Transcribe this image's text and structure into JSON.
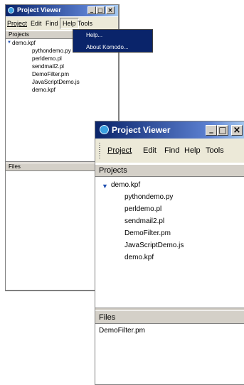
{
  "small_window": {
    "title": "Project Viewer",
    "controls": {
      "minimize": "_",
      "maximize": "□",
      "close": "×"
    },
    "menu": [
      "Project",
      "Edit",
      "Find",
      "Help",
      "Tools"
    ],
    "open_menu": "Help",
    "help_menu": [
      "Help...",
      "About Komodo..."
    ],
    "projects_header": "Projects",
    "tree": {
      "root": "demo.kpf",
      "children": [
        "pythondemo.py",
        "perldemo.pl",
        "sendmail2.pl",
        "DemoFilter.pm",
        "JavaScriptDemo.js",
        "demo.kpf"
      ]
    },
    "files_header": "Files"
  },
  "large_window": {
    "title": "Project Viewer",
    "controls": {
      "minimize": "_",
      "maximize": "□",
      "close": "×"
    },
    "menu": [
      "Project",
      "Edit",
      "Find",
      "Help",
      "Tools"
    ],
    "projects_header": "Projects",
    "tree": {
      "root": "demo.kpf",
      "children": [
        "pythondemo.py",
        "perldemo.pl",
        "sendmail2.pl",
        "DemoFilter.pm",
        "JavaScriptDemo.js",
        "demo.kpf"
      ]
    },
    "files_header": "Files",
    "files": [
      "DemoFilter.pm"
    ]
  },
  "colors": {
    "title_active": "#0a246a",
    "menu_highlight": "#0a246a",
    "tree_twisty": "#1f4fb0"
  }
}
